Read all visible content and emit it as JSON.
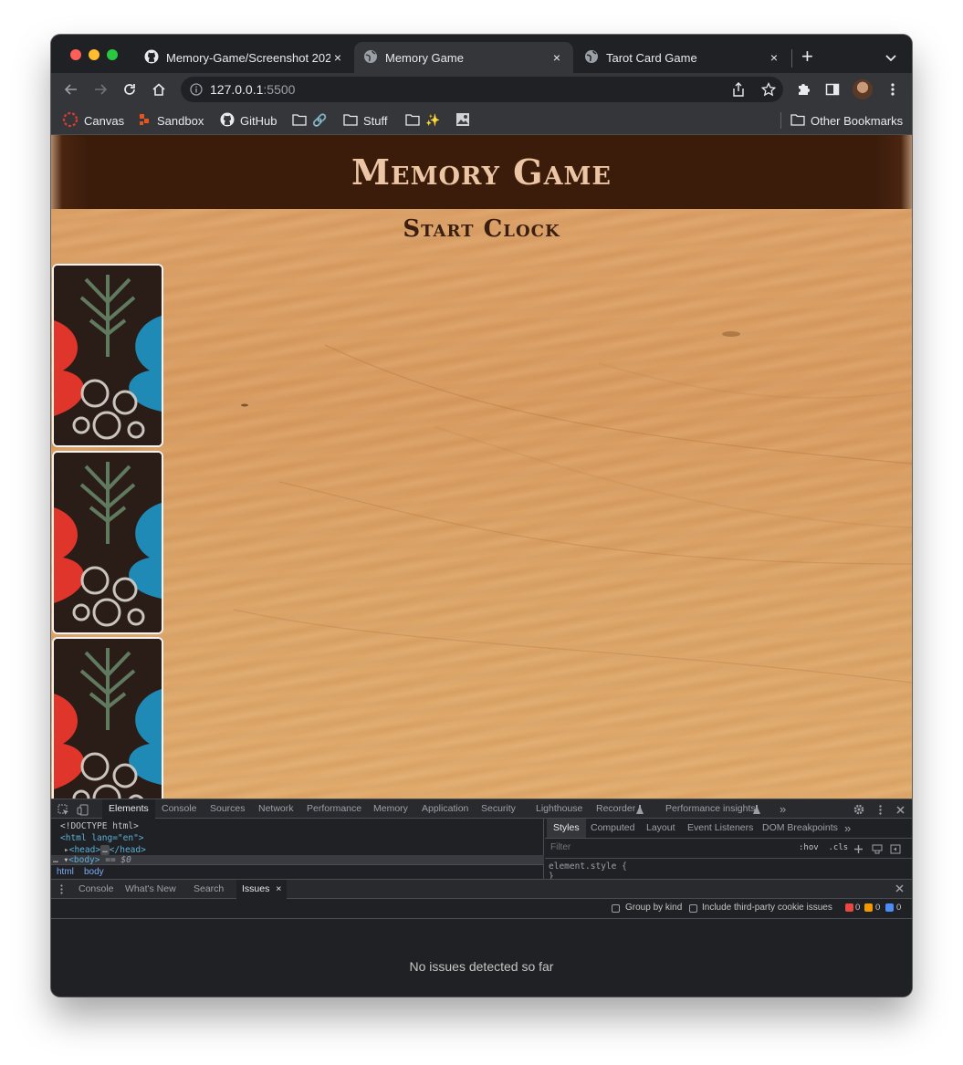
{
  "browser": {
    "tabs": [
      {
        "title": "Memory-Game/Screenshot 202",
        "icon": "github-icon",
        "active": false
      },
      {
        "title": "Memory Game",
        "icon": "globe-icon",
        "active": true
      },
      {
        "title": "Tarot Card Game",
        "icon": "globe-icon",
        "active": false
      }
    ],
    "close_glyph": "×",
    "new_tab_glyph": "+",
    "url_host": "127.0.0.1",
    "url_port": ":5500"
  },
  "bookmarks": [
    {
      "label": "Canvas",
      "icon": "canvas-icon"
    },
    {
      "label": "Sandbox",
      "icon": "sandbox-icon"
    },
    {
      "label": "GitHub",
      "icon": "github-icon"
    },
    {
      "label": "🔗",
      "icon": "folder-icon"
    },
    {
      "label": "Stuff",
      "icon": "folder-icon"
    },
    {
      "label": "✨",
      "icon": "folder-icon"
    },
    {
      "label": "",
      "icon": "image-bookmark-icon"
    },
    {
      "label": "Other Bookmarks",
      "icon": "folder-icon"
    }
  ],
  "page": {
    "title": "Memory Game",
    "start_button": "Start Clock",
    "card_count": 3
  },
  "devtools": {
    "main_tabs": [
      "Elements",
      "Console",
      "Sources",
      "Network",
      "Performance",
      "Memory",
      "Application",
      "Security",
      "Lighthouse",
      "Recorder",
      "Performance insights"
    ],
    "more_glyph": "»",
    "code": {
      "doctype": "<!DOCTYPE html>",
      "html_open": "<html lang=\"en\">",
      "head": "<head>",
      "head_close": "</head>",
      "body": "<body>",
      "body_suffix": "== $0"
    },
    "breadcrumbs": [
      "html",
      "body"
    ],
    "style_tabs": [
      "Styles",
      "Computed",
      "Layout",
      "Event Listeners",
      "DOM Breakpoints"
    ],
    "filter_placeholder": "Filter",
    "filter_tools": ":hov  .cls",
    "element_style": "element.style {",
    "close_brace": "}",
    "drawer_tabs": [
      "Console",
      "What's New",
      "Search",
      "Issues"
    ],
    "issues_close": "×",
    "group_by_kind": "Group by kind",
    "third_party": "Include third-party cookie issues",
    "counts": {
      "errors": "0",
      "warnings": "0",
      "info": "0"
    },
    "no_issues": "No issues detected so far"
  },
  "colors": {
    "header_brown": "#3b1c0b",
    "title_color": "#ecc6a4",
    "wood": "#dda268",
    "devtools_bg": "#202124"
  }
}
